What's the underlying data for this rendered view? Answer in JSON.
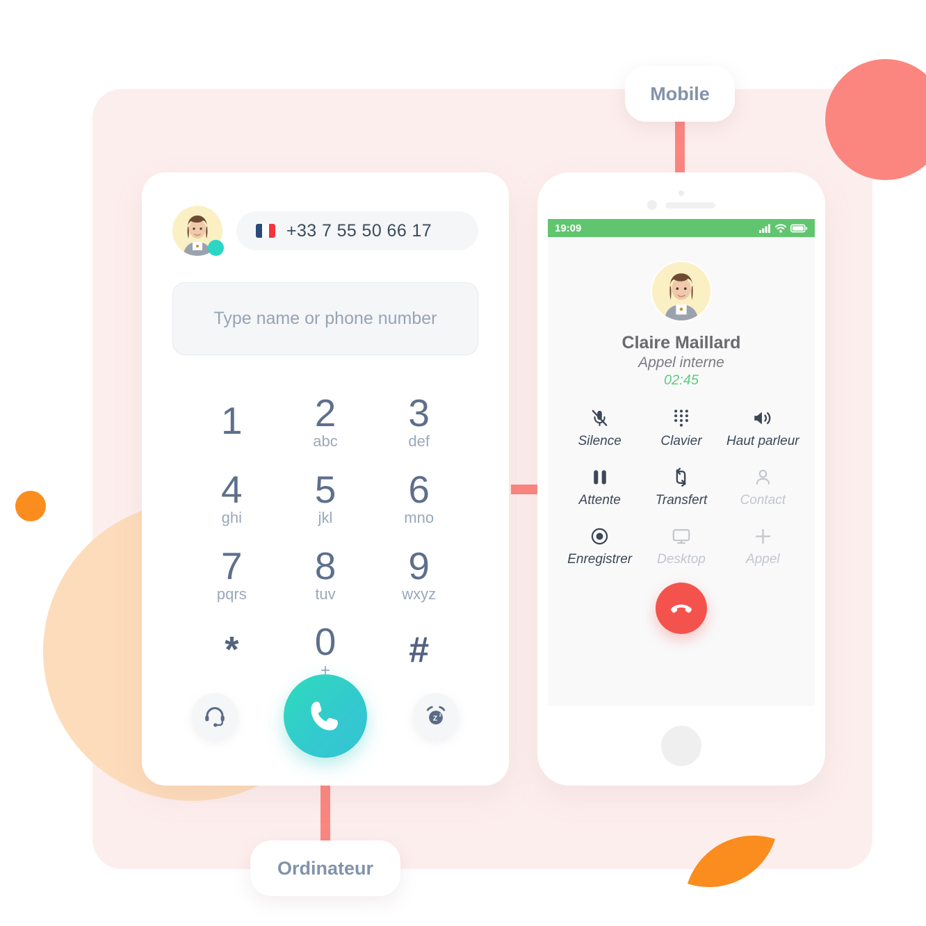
{
  "labels": {
    "mobile": "Mobile",
    "computer": "Ordinateur"
  },
  "dialer": {
    "phone_number": "+33 7 55 50 66 17",
    "flag_icon": "flag-france-icon",
    "search_placeholder": "Type name or phone number",
    "search_value": "",
    "keys": [
      {
        "digit": "1",
        "sub": ""
      },
      {
        "digit": "2",
        "sub": "abc"
      },
      {
        "digit": "3",
        "sub": "def"
      },
      {
        "digit": "4",
        "sub": "ghi"
      },
      {
        "digit": "5",
        "sub": "jkl"
      },
      {
        "digit": "6",
        "sub": "mno"
      },
      {
        "digit": "7",
        "sub": "pqrs"
      },
      {
        "digit": "8",
        "sub": "tuv"
      },
      {
        "digit": "9",
        "sub": "wxyz"
      },
      {
        "digit": "*",
        "sub": ""
      },
      {
        "digit": "0",
        "sub": "+"
      },
      {
        "digit": "#",
        "sub": ""
      }
    ],
    "footer": {
      "headset_icon": "headset-icon",
      "call_icon": "phone-handset-icon",
      "snooze_icon": "alarm-snooze-icon"
    },
    "status": "online"
  },
  "phone": {
    "statusbar": {
      "time": "19:09",
      "signal_icon": "signal-bars-icon",
      "wifi_icon": "wifi-icon",
      "battery_icon": "battery-full-icon"
    },
    "call": {
      "name": "Claire Maillard",
      "type": "Appel interne",
      "duration": "02:45"
    },
    "controls": [
      {
        "label": "Silence",
        "icon": "microphone-muted-icon",
        "disabled": false
      },
      {
        "label": "Clavier",
        "icon": "keypad-dots-icon",
        "disabled": false
      },
      {
        "label": "Haut parleur",
        "icon": "speaker-loud-icon",
        "disabled": false
      },
      {
        "label": "Attente",
        "icon": "pause-icon",
        "disabled": false
      },
      {
        "label": "Transfert",
        "icon": "transfer-arrows-icon",
        "disabled": false
      },
      {
        "label": "Contact",
        "icon": "person-icon",
        "disabled": true
      },
      {
        "label": "Enregistrer",
        "icon": "record-icon",
        "disabled": false
      },
      {
        "label": "Desktop",
        "icon": "monitor-icon",
        "disabled": true
      },
      {
        "label": "Appel",
        "icon": "plus-icon",
        "disabled": true
      }
    ],
    "hangup_icon": "hangup-handset-icon",
    "home_button": "home-button"
  },
  "colors": {
    "panel_bg": "#fdeeee",
    "accent_pink": "#fb8680",
    "accent_orange": "#fb8c1e",
    "accent_peach": "#fddcbb",
    "call_teal": "#2fdbbc",
    "hangup_red": "#f4534d",
    "status_green": "#61c56f",
    "timer_green": "#5fcc7e",
    "label_slate": "#8193ab"
  }
}
